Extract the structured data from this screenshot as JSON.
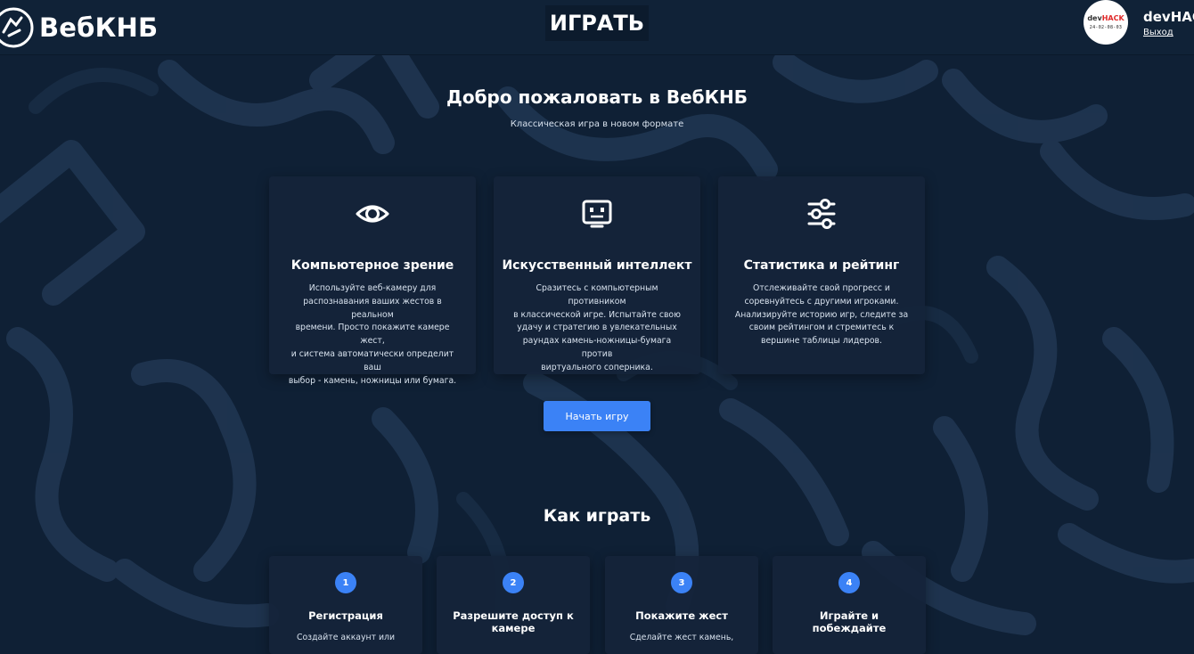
{
  "header": {
    "logo_text": "ВебКНБ",
    "nav_play": "ИГРАТЬ",
    "avatar_brand_prefix": "dev",
    "avatar_brand_highlight": "HACK",
    "avatar_date": "24-02-08-03",
    "user_name": "devHACK",
    "logout": "Выход"
  },
  "welcome": {
    "title": "Добро пожаловать в ВебКНБ",
    "subtitle": "Классическая игра в новом формате"
  },
  "features": [
    {
      "icon": "eye-icon",
      "title": "Компьютерное зрение",
      "lines": [
        "Используйте веб-камеру для",
        "распознавания ваших жестов в реальном",
        "времени. Просто покажите камере жест,",
        "и система автоматически определит ваш",
        "выбор - камень, ножницы или бумага."
      ]
    },
    {
      "icon": "robot-icon",
      "title": "Искусственный интеллект",
      "lines": [
        "Сразитесь с компьютерным противником",
        "в классической игре. Испытайте свою",
        "удачу и стратегию в увлекательных",
        "раундах камень-ножницы-бумага против",
        "виртуального соперника."
      ]
    },
    {
      "icon": "sliders-icon",
      "title": "Статистика и рейтинг",
      "lines": [
        "Отслеживайте свой прогресс и",
        "соревнуйтесь с другими игроками.",
        "Анализируйте историю игр, следите за",
        "своим рейтингом и стремитесь к",
        "вершине таблицы лидеров."
      ]
    }
  ],
  "start_button": "Начать игру",
  "howto": {
    "title": "Как играть",
    "steps": [
      {
        "num": "1",
        "title_lines": [
          "Регистрация"
        ],
        "desc": "Создайте аккаунт или"
      },
      {
        "num": "2",
        "title_lines": [
          "Разрешите доступ к",
          "камере"
        ],
        "desc": ""
      },
      {
        "num": "3",
        "title_lines": [
          "Покажите жест"
        ],
        "desc": "Сделайте жест камень,"
      },
      {
        "num": "4",
        "title_lines": [
          "Играйте и",
          "побеждайте"
        ],
        "desc": ""
      }
    ]
  },
  "colors": {
    "background": "#0f2035",
    "card": "#14243a",
    "accent": "#3b82f6",
    "text": "#ffffff"
  }
}
